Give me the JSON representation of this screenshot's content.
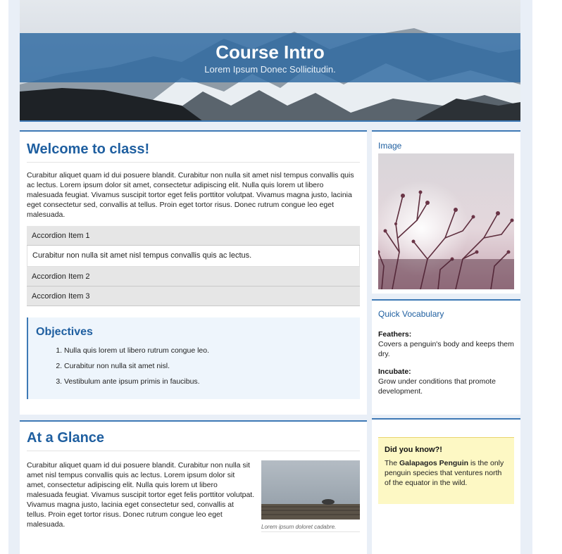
{
  "banner": {
    "title": "Course Intro",
    "subtitle": "Lorem Ipsum Donec Sollicitudin."
  },
  "welcome": {
    "heading": "Welcome to class!",
    "paragraph": "Curabitur aliquet quam id dui posuere blandit. Curabitur non nulla sit amet nisl tempus convallis quis ac lectus. Lorem ipsum dolor sit amet, consectetur adipiscing elit. Nulla quis lorem ut libero malesuada feugiat. Vivamus suscipit tortor eget felis porttitor volutpat. Vivamus magna justo, lacinia eget consectetur sed, convallis at tellus. Proin eget tortor risus. Donec rutrum congue leo eget malesuada.",
    "accordion": [
      {
        "label": "Accordion Item 1",
        "content": "Curabitur non nulla sit amet nisl tempus convallis quis ac lectus."
      },
      {
        "label": "Accordion Item 2"
      },
      {
        "label": "Accordion Item 3"
      }
    ]
  },
  "objectives": {
    "heading": "Objectives",
    "items": [
      "Nulla quis lorem ut libero rutrum congue leo.",
      "Curabitur non nulla sit amet nisl.",
      "Vestibulum ante ipsum primis in faucibus."
    ]
  },
  "glance": {
    "heading": "At a Glance",
    "paragraph": "Curabitur aliquet quam id dui posuere blandit. Curabitur non nulla sit amet nisl tempus convallis quis ac lectus. Lorem ipsum dolor sit amet, consectetur adipiscing elit. Nulla quis lorem ut libero malesuada feugiat. Vivamus suscipit tortor eget felis porttitor volutpat. Vivamus magna justo, lacinia eget consectetur sed, convallis at tellus. Proin eget tortor risus. Donec rutrum congue leo eget malesuada.",
    "caption": "Lorem ipsum doloret cadabre."
  },
  "sidebar": {
    "image_title": "Image",
    "vocab_title": "Quick Vocabulary",
    "vocab": [
      {
        "term": "Feathers:",
        "definition": "Covers a penguin's body and keeps them dry."
      },
      {
        "term": "Incubate:",
        "definition": "Grow under conditions that promote development."
      }
    ],
    "did_you_know": {
      "heading": "Did you know?!",
      "text_before": "The ",
      "bold": "Galapagos Penguin",
      "text_after": " is the only penguin species that ventures north of the equator in the wild."
    }
  },
  "colors": {
    "accent": "#3e79b5",
    "heading": "#1f5fa0",
    "note_bg": "#fdf8c4"
  }
}
